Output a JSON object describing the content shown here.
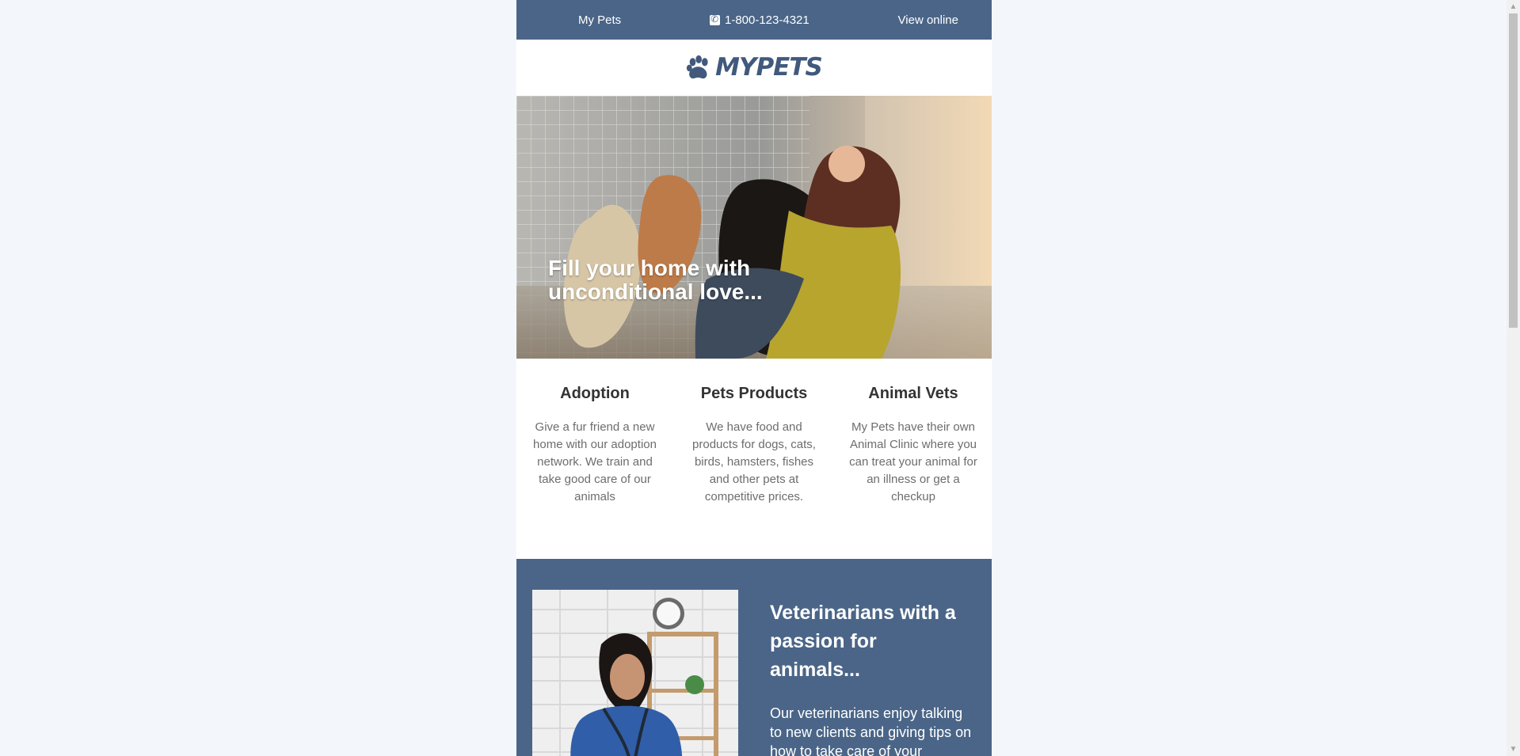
{
  "header": {
    "brand_link": "My Pets",
    "phone": "1-800-123-4321",
    "view_online": "View online"
  },
  "logo": {
    "text": "MYPETS"
  },
  "hero": {
    "headline": "Fill your home with unconditional love..."
  },
  "features": [
    {
      "title": "Adoption",
      "text": "Give a fur friend a new home with our adoption network. We train and take good care of our animals"
    },
    {
      "title": "Pets Products",
      "text": "We have food and products for dogs, cats, birds, hamsters, fishes and other pets at competitive prices."
    },
    {
      "title": "Animal Vets",
      "text": "My Pets have their own Animal Clinic where you can treat your animal for an illness or get a checkup"
    }
  ],
  "vets": {
    "heading": "Veterinarians with a passion for animals...",
    "text": "Our veterinarians enjoy talking to new clients and giving tips on how to take care of your animal."
  },
  "icons": {
    "phone": "phone-icon",
    "paw": "paw-icon",
    "scroll_up": "chevron-up-icon",
    "scroll_down": "chevron-down-icon"
  },
  "colors": {
    "brand": "#4a6587",
    "page_background": "#f3f7fb",
    "heading_text": "#333333",
    "body_text": "#6d6d6d"
  }
}
